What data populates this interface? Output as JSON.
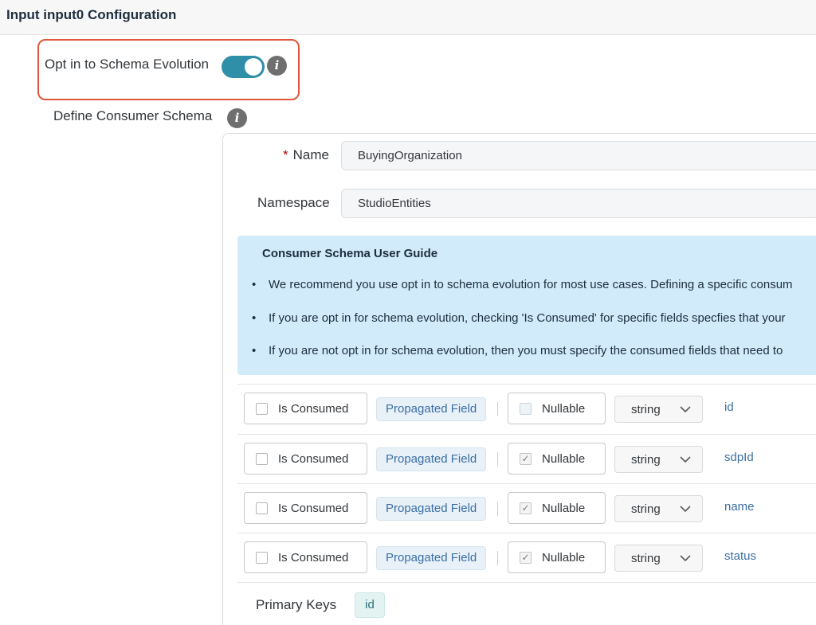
{
  "header": {
    "title": "Input input0 Configuration"
  },
  "schema_evolution": {
    "label": "Opt in to Schema Evolution",
    "toggle_on": true,
    "accent_color": "#2f8fa8",
    "highlight_color": "#e0553b"
  },
  "consumer_schema": {
    "label": "Define Consumer Schema",
    "name_label": "Name",
    "required_marker": "*",
    "name_value": "BuyingOrganization",
    "namespace_label": "Namespace",
    "namespace_value": "StudioEntities"
  },
  "guide": {
    "title": "Consumer Schema User Guide",
    "bullet": "•",
    "items": [
      "We recommend you use opt in to schema evolution for most use cases. Defining a specific consum",
      "If you are opt in for schema evolution, checking 'Is Consumed' for specific fields specfies that your",
      "If you are not opt in for schema evolution, then you must specify the consumed fields that need to"
    ]
  },
  "fields": {
    "is_consumed_label": "Is Consumed",
    "propagated_label": "Propagated Field",
    "nullable_label": "Nullable",
    "check_glyph": "✓",
    "rows": [
      {
        "name": "id",
        "type": "string",
        "is_consumed": false,
        "nullable": false
      },
      {
        "name": "sdpId",
        "type": "string",
        "is_consumed": false,
        "nullable": true
      },
      {
        "name": "name",
        "type": "string",
        "is_consumed": false,
        "nullable": true
      },
      {
        "name": "status",
        "type": "string",
        "is_consumed": false,
        "nullable": true
      }
    ]
  },
  "primary_keys": {
    "label": "Primary Keys",
    "values": [
      "id"
    ]
  },
  "icons": {
    "info": "info-icon",
    "chevron": "chevron-down-icon"
  }
}
